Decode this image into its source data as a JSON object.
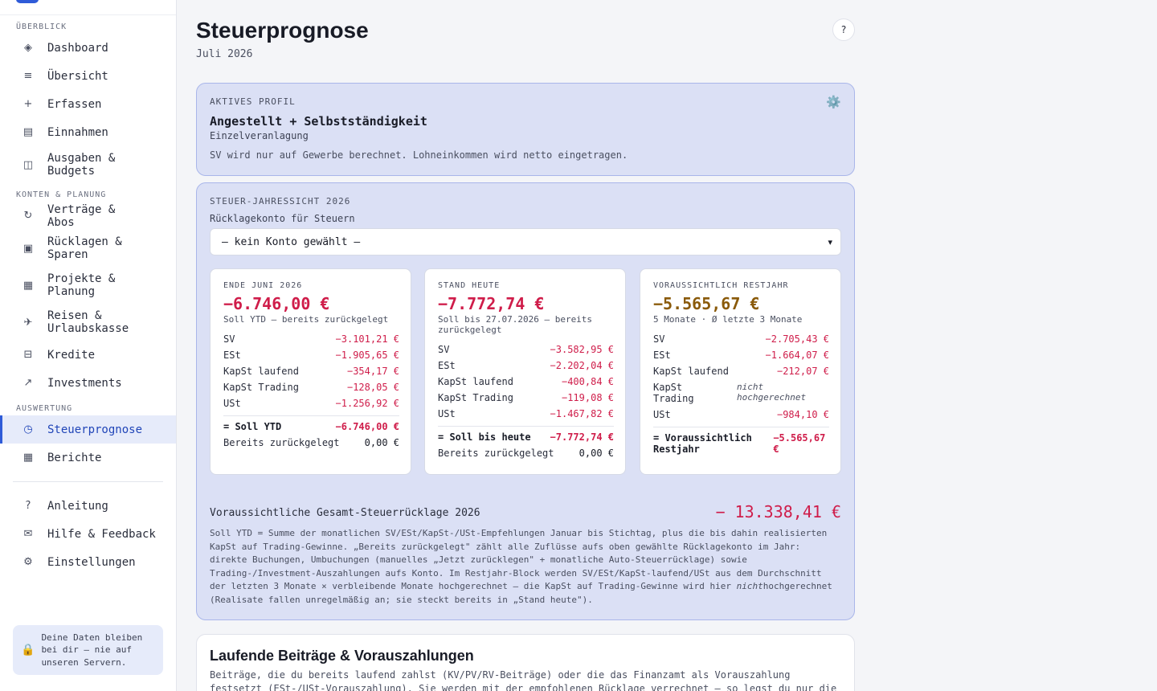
{
  "sidebar": {
    "sections": {
      "overview": "ÜBERBLICK",
      "accounts": "KONTEN & PLANUNG",
      "analysis": "AUSWERTUNG"
    },
    "items": [
      {
        "icon": "◈",
        "label": "Dashboard"
      },
      {
        "icon": "≡",
        "label": "Übersicht"
      },
      {
        "icon": "+",
        "label": "Erfassen"
      },
      {
        "icon": "▤",
        "label": "Einnahmen"
      },
      {
        "icon": "◫",
        "label": "Ausgaben & Budgets"
      },
      {
        "icon": "↻",
        "label": "Verträge & Abos"
      },
      {
        "icon": "▣",
        "label": "Rücklagen & Sparen"
      },
      {
        "icon": "▦",
        "label": "Projekte & Planung"
      },
      {
        "icon": "✈",
        "label": "Reisen & Urlaubskasse"
      },
      {
        "icon": "⊟",
        "label": "Kredite"
      },
      {
        "icon": "↗",
        "label": "Investments"
      },
      {
        "icon": "◷",
        "label": "Steuerprognose"
      },
      {
        "icon": "▦",
        "label": "Berichte"
      },
      {
        "icon": "?",
        "label": "Anleitung"
      },
      {
        "icon": "✉",
        "label": "Hilfe & Feedback"
      },
      {
        "icon": "⚙",
        "label": "Einstellungen"
      }
    ],
    "privacy": {
      "icon": "🔒",
      "text": "Deine Daten bleiben bei dir – nie auf unseren Servern."
    }
  },
  "header": {
    "title": "Steuerprognose",
    "subtitle": "Juli 2026",
    "help": "?"
  },
  "profile": {
    "caption": "AKTIVES PROFIL",
    "gear": "⚙️",
    "name": "Angestellt + Selbstständigkeit",
    "mode": "Einzelveranlagung",
    "note": "SV wird nur auf Gewerbe berechnet. Lohneinkommen wird netto eingetragen."
  },
  "tax": {
    "caption": "STEUER-JAHRESSICHT 2026",
    "account_label": "Rücklagekonto für Steuern",
    "account_value": "— kein Konto gewählt —",
    "columns": [
      {
        "caption": "ENDE JUNI 2026",
        "amount": "−6.746,00 €",
        "meta": "Soll YTD – bereits zurückgelegt",
        "rows": [
          {
            "label": "SV",
            "value": "−3.101,21 €"
          },
          {
            "label": "ESt",
            "value": "−1.905,65 €"
          },
          {
            "label": "KapSt laufend",
            "value": "−354,17 €"
          },
          {
            "label": "KapSt Trading",
            "value": "−128,05 €"
          },
          {
            "label": "USt",
            "value": "−1.256,92 €"
          }
        ],
        "sum_label": "= Soll YTD",
        "sum_value": "−6.746,00 €",
        "saved_label": "Bereits zurückgelegt",
        "saved_value": "0,00 €"
      },
      {
        "caption": "STAND HEUTE",
        "amount": "−7.772,74 €",
        "meta": "Soll bis 27.07.2026 – bereits zurückgelegt",
        "rows": [
          {
            "label": "SV",
            "value": "−3.582,95 €"
          },
          {
            "label": "ESt",
            "value": "−2.202,04 €"
          },
          {
            "label": "KapSt laufend",
            "value": "−400,84 €"
          },
          {
            "label": "KapSt Trading",
            "value": "−119,08 €"
          },
          {
            "label": "USt",
            "value": "−1.467,82 €"
          }
        ],
        "sum_label": "= Soll bis heute",
        "sum_value": "−7.772,74 €",
        "saved_label": "Bereits zurückgelegt",
        "saved_value": "0,00 €"
      },
      {
        "caption": "VORAUSSICHTLICH RESTJAHR",
        "amount": "−5.565,67 €",
        "meta": "5 Monate · Ø letzte 3 Monate",
        "rows": [
          {
            "label": "SV",
            "value": "−2.705,43 €"
          },
          {
            "label": "ESt",
            "value": "−1.664,07 €"
          },
          {
            "label": "KapSt laufend",
            "value": "−212,07 €"
          },
          {
            "label": "KapSt Trading",
            "value": "nicht hochgerechnet"
          },
          {
            "label": "USt",
            "value": "−984,10 €"
          }
        ],
        "sum_label": "= Voraussichtlich Restjahr",
        "sum_value": "−5.565,67 €"
      }
    ],
    "total_label": "Voraussichtliche Gesamt-Steuerrücklage 2026",
    "total_value": "− 13.338,41 €",
    "explanation_a": "Soll YTD = Summe der monatlichen SV/ESt/KapSt-/USt-Empfehlungen Januar bis Stichtag, plus die bis dahin realisierten KapSt auf Trading-Gewinne. „Bereits zurückgelegt\" zählt alle Zuflüsse aufs oben gewählte Rücklagekonto im Jahr: direkte Buchungen, Umbuchungen (manuelles „Jetzt zurücklegen\" + monatliche Auto-Steuerrücklage) sowie Trading-/Investment-Auszahlungen aufs Konto. Im Restjahr-Block werden SV/ESt/KapSt-laufend/USt aus dem Durchschnitt der letzten 3 Monate × verbleibende Monate hochgerechnet – die KapSt auf Trading-Gewinne wird hier ",
    "explanation_em": "nicht",
    "explanation_b": "hochgerechnet (Realisate fallen unregelmäßig an; sie steckt bereits in „Stand heute\")."
  },
  "running": {
    "title": "Laufende Beiträge & Vorauszahlungen",
    "description": "Beiträge, die du bereits laufend zahlst (KV/PV/RV-Beiträge) oder die das Finanzamt als Vorauszahlung festsetzt (ESt-/USt-Vorauszahlung). Sie werden mit der empfohlenen Rücklage verrechnet – so legst du nur die"
  }
}
